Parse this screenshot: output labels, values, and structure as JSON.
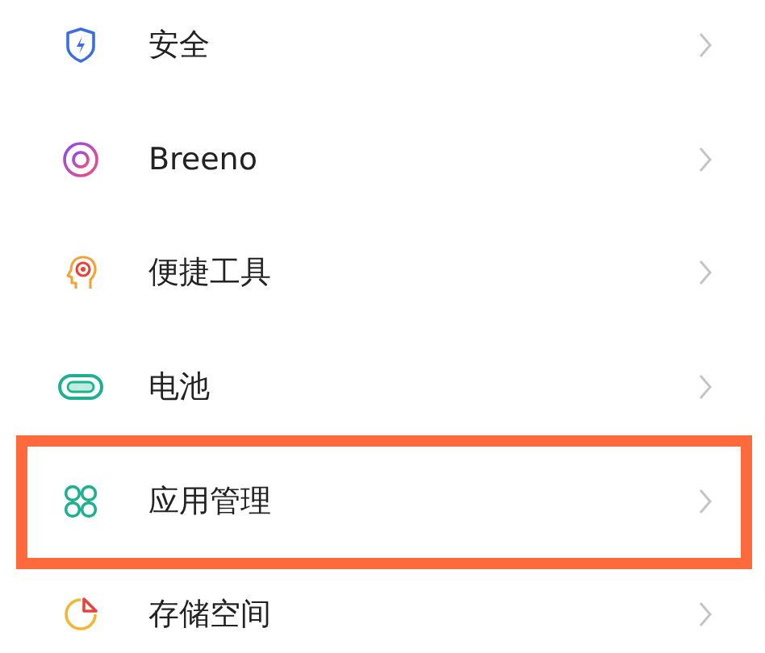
{
  "items": [
    {
      "label": "安全",
      "kind": "shield",
      "highlighted": false
    },
    {
      "label": "Breeno",
      "kind": "ring",
      "highlighted": false
    },
    {
      "label": "便捷工具",
      "kind": "head",
      "highlighted": false
    },
    {
      "label": "电池",
      "kind": "battery",
      "highlighted": false
    },
    {
      "label": "应用管理",
      "kind": "apps",
      "highlighted": true
    },
    {
      "label": "存储空间",
      "kind": "pie",
      "highlighted": false
    }
  ]
}
